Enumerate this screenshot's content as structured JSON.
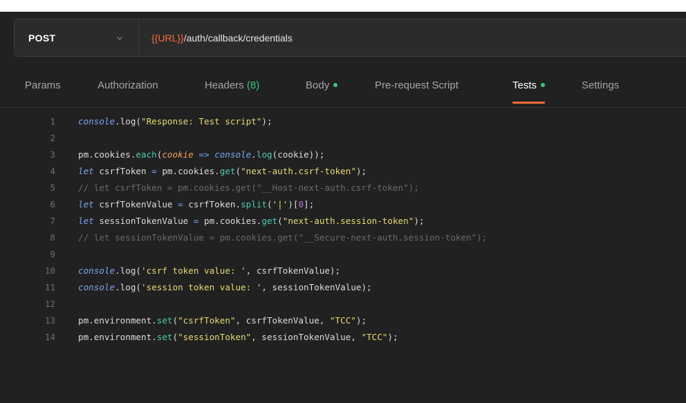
{
  "request": {
    "method": "POST",
    "url_var": "{{URL}}",
    "url_path": "/auth/callback/credentials"
  },
  "tabs": [
    {
      "label": "Params"
    },
    {
      "label": "Authorization"
    },
    {
      "label": "Headers",
      "count": "(8)"
    },
    {
      "label": "Body"
    },
    {
      "label": "Pre-request Script"
    },
    {
      "label": "Tests"
    },
    {
      "label": "Settings"
    }
  ],
  "active_tab": "Tests",
  "colors": {
    "accent": "#ff6c37",
    "status_dot": "#3cc77e"
  },
  "editor": {
    "lines": [
      {
        "n": "1",
        "t": [
          [
            "console",
            "kw"
          ],
          [
            ".log(",
            "p"
          ],
          [
            "\"Response: Test script\"",
            "str"
          ],
          [
            ");",
            "p"
          ]
        ]
      },
      {
        "n": "2",
        "t": []
      },
      {
        "n": "3",
        "t": [
          [
            "pm.cookies.",
            "p"
          ],
          [
            "each",
            "fn"
          ],
          [
            "(",
            "p"
          ],
          [
            "cookie",
            "param"
          ],
          [
            " => ",
            "kw"
          ],
          [
            "console",
            "kw"
          ],
          [
            ".",
            "p"
          ],
          [
            "log",
            "fn"
          ],
          [
            "(cookie));",
            "p"
          ]
        ]
      },
      {
        "n": "4",
        "t": [
          [
            "let",
            "kw"
          ],
          [
            " csrfToken ",
            "p"
          ],
          [
            "=",
            "kw"
          ],
          [
            " pm.cookies.",
            "p"
          ],
          [
            "get",
            "fn"
          ],
          [
            "(",
            "p"
          ],
          [
            "\"next-auth.csrf-token\"",
            "str"
          ],
          [
            ");",
            "p"
          ]
        ]
      },
      {
        "n": "5",
        "t": [
          [
            "// let csrfToken = pm.cookies.get(\"__Host-next-auth.csrf-token\");",
            "cm"
          ]
        ]
      },
      {
        "n": "6",
        "t": [
          [
            "let",
            "kw"
          ],
          [
            " csrfTokenValue ",
            "p"
          ],
          [
            "=",
            "kw"
          ],
          [
            " csrfToken.",
            "p"
          ],
          [
            "split",
            "fn"
          ],
          [
            "(",
            "p"
          ],
          [
            "'|'",
            "str"
          ],
          [
            ")[",
            "p"
          ],
          [
            "0",
            "num"
          ],
          [
            "];",
            "p"
          ]
        ]
      },
      {
        "n": "7",
        "t": [
          [
            "let",
            "kw"
          ],
          [
            " sessionTokenValue ",
            "p"
          ],
          [
            "=",
            "kw"
          ],
          [
            " pm.cookies.",
            "p"
          ],
          [
            "get",
            "fn"
          ],
          [
            "(",
            "p"
          ],
          [
            "\"next-auth.session-token\"",
            "str"
          ],
          [
            ");",
            "p"
          ]
        ]
      },
      {
        "n": "8",
        "t": [
          [
            "// let sessionTokenValue = pm.cookies.get(\"__Secure-next-auth.session-token\");",
            "cm"
          ]
        ]
      },
      {
        "n": "9",
        "t": []
      },
      {
        "n": "10",
        "t": [
          [
            "console",
            "kw"
          ],
          [
            ".log(",
            "p"
          ],
          [
            "'csrf token value: '",
            "str"
          ],
          [
            ", csrfTokenValue);",
            "p"
          ]
        ]
      },
      {
        "n": "11",
        "t": [
          [
            "console",
            "kw"
          ],
          [
            ".log(",
            "p"
          ],
          [
            "'session token value: '",
            "str"
          ],
          [
            ", sessionTokenValue);",
            "p"
          ]
        ]
      },
      {
        "n": "12",
        "t": []
      },
      {
        "n": "13",
        "t": [
          [
            "pm.environment.",
            "p"
          ],
          [
            "set",
            "fn"
          ],
          [
            "(",
            "p"
          ],
          [
            "\"csrfToken\"",
            "str"
          ],
          [
            ", csrfTokenValue, ",
            "p"
          ],
          [
            "\"TCC\"",
            "str"
          ],
          [
            ");",
            "p"
          ]
        ]
      },
      {
        "n": "14",
        "t": [
          [
            "pm.environment.",
            "p"
          ],
          [
            "set",
            "fn"
          ],
          [
            "(",
            "p"
          ],
          [
            "\"sessionToken\"",
            "str"
          ],
          [
            ", sessionTokenValue, ",
            "p"
          ],
          [
            "\"TCC\"",
            "str"
          ],
          [
            ");",
            "p"
          ]
        ]
      }
    ]
  }
}
